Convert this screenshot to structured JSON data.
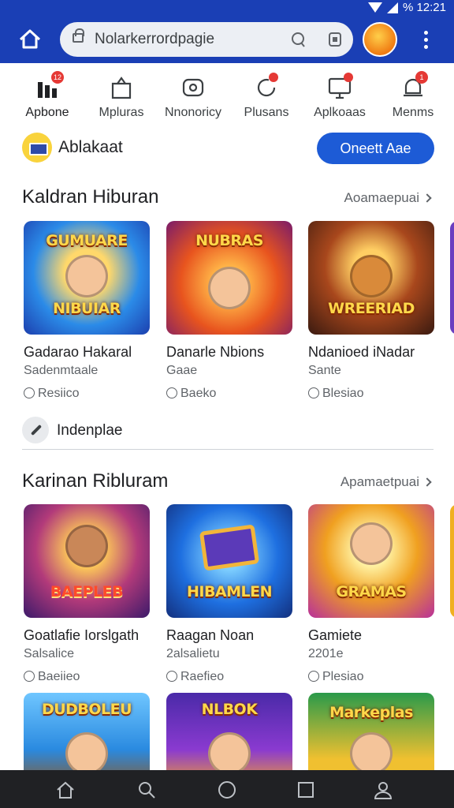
{
  "status": {
    "battery": "% 12:21"
  },
  "toolbar": {
    "url": "Nolarkerrordpagie"
  },
  "nav": [
    {
      "label": "Apbone",
      "badge": "12"
    },
    {
      "label": "Mpluras",
      "badge": ""
    },
    {
      "label": "Nnonoricy",
      "badge": ""
    },
    {
      "label": "Plusans",
      "badge": ""
    },
    {
      "label": "Aplkoaas",
      "badge": ""
    },
    {
      "label": "Menms",
      "badge": "1"
    }
  ],
  "applet": {
    "title": "Ablakaat",
    "button": "Oneett Aae"
  },
  "section1": {
    "title": "Kaldran Hiburan",
    "link": "Aoamaepuai",
    "cards": [
      {
        "thumb": "NIBUIAR",
        "thumb_top": "GUMUARE",
        "title": "Gadarao Hakaral",
        "sub": "Sadenmtaale",
        "meta": "Resiico"
      },
      {
        "thumb": "",
        "thumb_top": "NUBRAS",
        "title": "Danarle Nbions",
        "sub": "Gaae",
        "meta": "Baeko"
      },
      {
        "thumb": "WREERIAD",
        "thumb_top": "",
        "title": "Ndanioed iNadar",
        "sub": "Sante",
        "meta": "Blesiao"
      }
    ]
  },
  "install_row": {
    "label": "Indenplae"
  },
  "section2": {
    "title": "Karinan Ribluram",
    "link": "Apamaetpuai",
    "cards": [
      {
        "thumb": "BAEPLEB",
        "thumb_top": "",
        "title": "Goatlafie Iorslgath",
        "sub": "Salsalice",
        "meta": "Baeiieo"
      },
      {
        "thumb": "HIBAMLEN",
        "thumb_top": "",
        "title": "Raagan Noan",
        "sub": "2alsalietu",
        "meta": "Raefieo"
      },
      {
        "thumb": "GRAMAS",
        "thumb_top": "",
        "title": "Gamiete",
        "sub": "2201e",
        "meta": "Plesiao"
      }
    ]
  },
  "section3": {
    "cards": [
      {
        "thumb_top": "DUDBOLEU"
      },
      {
        "thumb_top": "NLBOK"
      },
      {
        "thumb_top": "Markeplas"
      }
    ]
  },
  "colors": {
    "brand": "#1a3fb5",
    "accent_button": "#1d5bd6",
    "badge": "#e53935"
  }
}
